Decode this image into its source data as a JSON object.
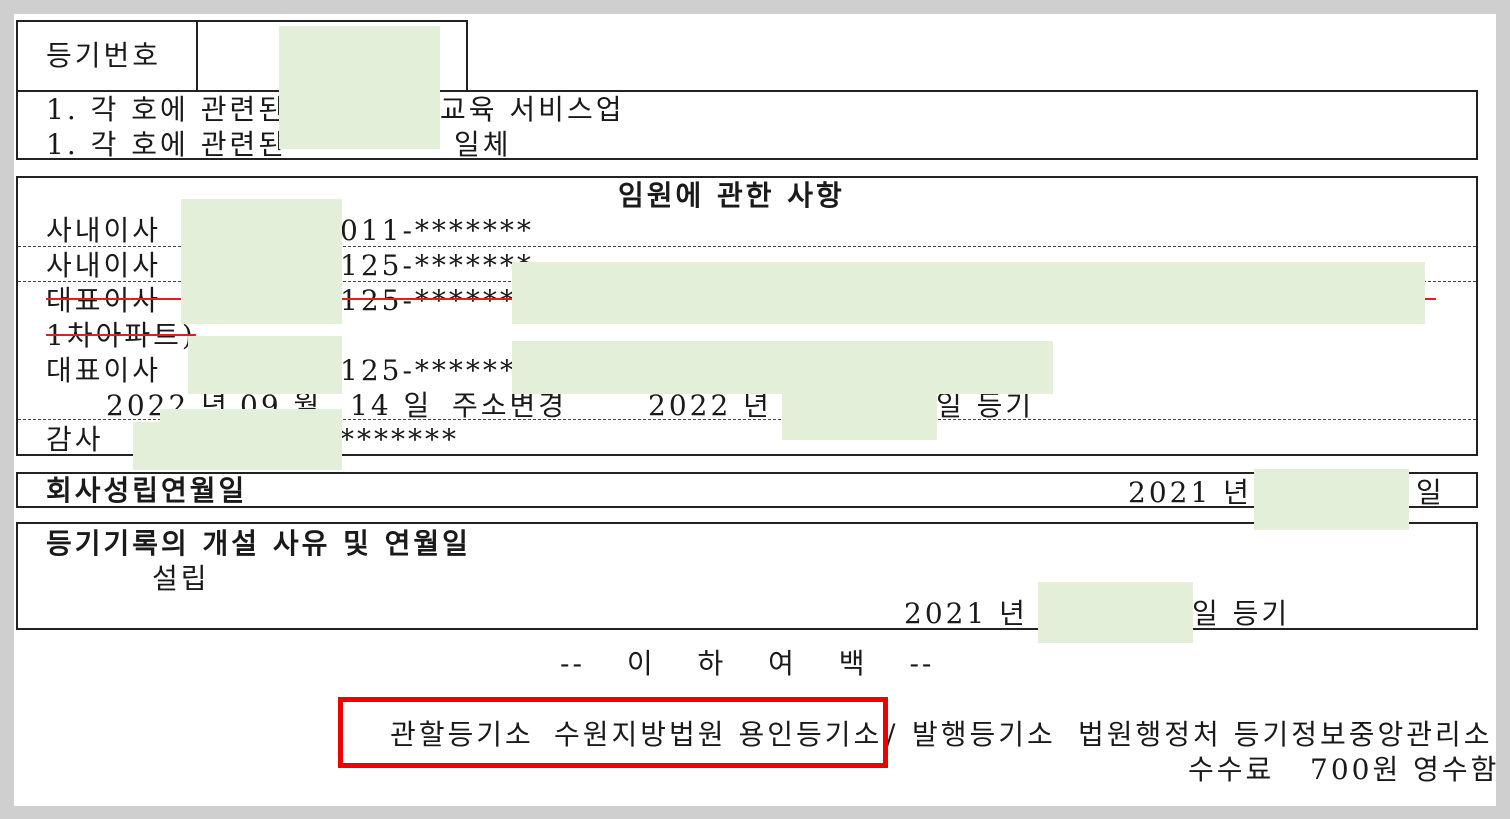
{
  "registration_number": {
    "label": "등기번호"
  },
  "purpose_lines": [
    "1. 각 호에 관련된",
    "교육 서비스업",
    "1. 각 호에 관련된",
    "일체"
  ],
  "officers": {
    "title": "임원에 관한 사항",
    "rows": [
      {
        "role": "사내이사",
        "id_suffix": "011-*******"
      },
      {
        "role": "사내이사",
        "id_suffix": "125-*******"
      },
      {
        "role": "대표이사",
        "id_suffix": "125-*******",
        "struck": true
      },
      {
        "role": "1차아파트)",
        "struck": true
      },
      {
        "role": "대표이사",
        "id_suffix": "125-*******"
      },
      {
        "note_year": "2022 년",
        "note_month": "09 월",
        "note_day": "14 일",
        "note_event": "주소변경",
        "note_year2": "2022 년",
        "note_tail": "일 등기"
      },
      {
        "role": "감사",
        "id_suffix": "*******"
      }
    ]
  },
  "establishment": {
    "label": "회사성립연월일",
    "year": "2021 년",
    "day_suffix": "일"
  },
  "record": {
    "label": "등기기록의 개설 사유 및 연월일",
    "reason": "설립",
    "year": "2021 년",
    "tail": "일 등기"
  },
  "end_mark": "-- 이 하 여 백 --",
  "footer": {
    "jurisdiction_label": "관할등기소",
    "jurisdiction_value": "수원지방법원 용인등기소",
    "separator": "/",
    "issuer_label": "발행등기소",
    "issuer_value": "법원행정처 등기정보중앙관리소",
    "fee_label": "수수료",
    "fee_value": "700원 영수함"
  },
  "colors": {
    "mask": "#e3efd9",
    "highlight": "#ee0000",
    "strike": "#e02020"
  }
}
